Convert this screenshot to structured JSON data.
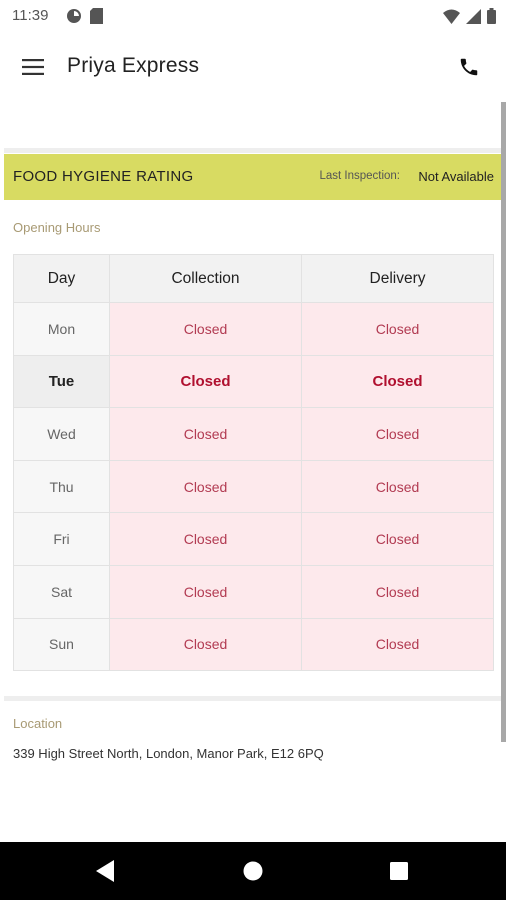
{
  "status_bar": {
    "time": "11:39"
  },
  "app_bar": {
    "title": "Priya Express"
  },
  "hygiene": {
    "title": "FOOD HYGIENE RATING",
    "inspection_label": "Last Inspection:",
    "inspection_value": "Not Available"
  },
  "opening_hours": {
    "label": "Opening Hours",
    "headers": [
      "Day",
      "Collection",
      "Delivery"
    ],
    "rows": [
      {
        "day": "Mon",
        "collection": "Closed",
        "delivery": "Closed"
      },
      {
        "day": "Tue",
        "collection": "Closed",
        "delivery": "Closed"
      },
      {
        "day": "Wed",
        "collection": "Closed",
        "delivery": "Closed"
      },
      {
        "day": "Thu",
        "collection": "Closed",
        "delivery": "Closed"
      },
      {
        "day": "Fri",
        "collection": "Closed",
        "delivery": "Closed"
      },
      {
        "day": "Sat",
        "collection": "Closed",
        "delivery": "Closed"
      },
      {
        "day": "Sun",
        "collection": "Closed",
        "delivery": "Closed"
      }
    ]
  },
  "location": {
    "label": "Location",
    "address": "339 High Street North, London, Manor Park, E12 6PQ"
  },
  "colors": {
    "hygiene_bar": "#d8db62",
    "closed_bg": "#fde9ec",
    "closed_text": "#b23b52",
    "section_label": "#a89a74"
  }
}
